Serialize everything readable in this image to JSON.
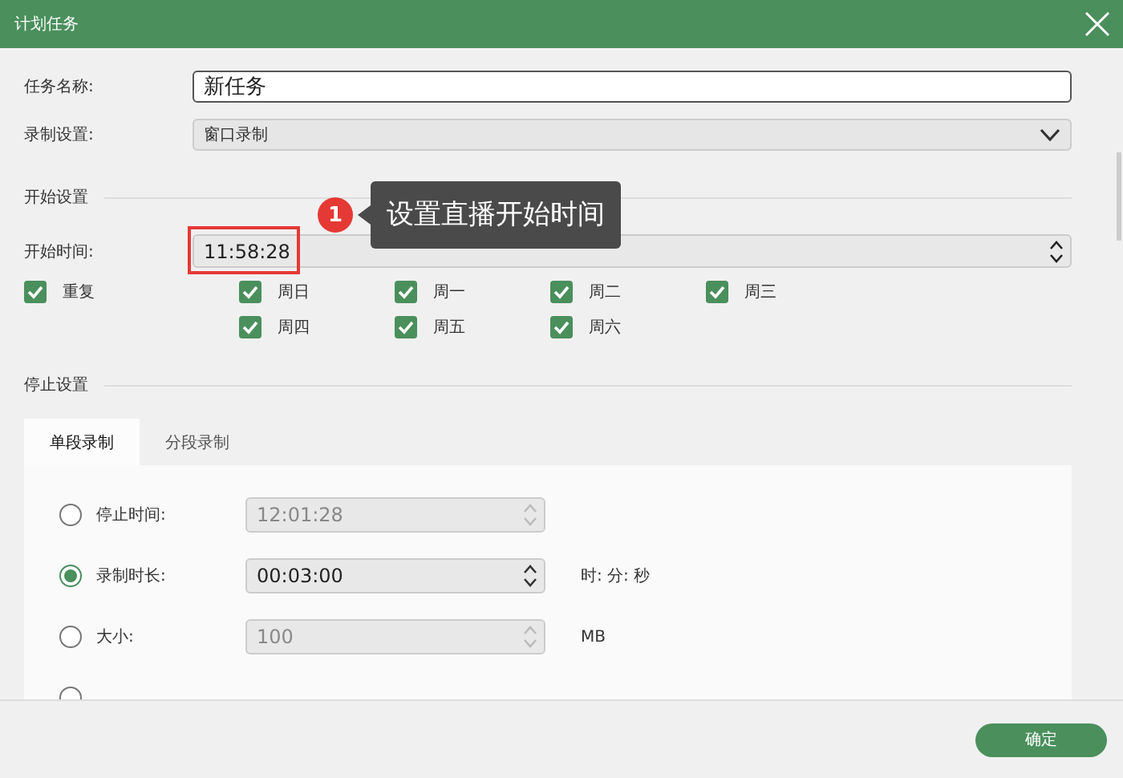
{
  "window": {
    "title": "计划任务"
  },
  "task_name": {
    "label": "任务名称:",
    "value": "新任务"
  },
  "record_setting": {
    "label": "录制设置:",
    "value": "窗口录制"
  },
  "start_section": {
    "title": "开始设置"
  },
  "start_time": {
    "label": "开始时间:",
    "value": "11:58:28",
    "highlighted": true
  },
  "repeat": {
    "label": "重复",
    "checked": true
  },
  "days": [
    {
      "label": "周日",
      "checked": true
    },
    {
      "label": "周一",
      "checked": true
    },
    {
      "label": "周二",
      "checked": true
    },
    {
      "label": "周三",
      "checked": true
    },
    {
      "label": "周四",
      "checked": true
    },
    {
      "label": "周五",
      "checked": true
    },
    {
      "label": "周六",
      "checked": true
    }
  ],
  "callout": {
    "number": "1",
    "text": "设置直播开始时间"
  },
  "stop_section": {
    "title": "停止设置"
  },
  "tabs": [
    {
      "label": "单段录制",
      "selected": true
    },
    {
      "label": "分段录制",
      "selected": false
    }
  ],
  "stop_options": [
    {
      "kind": "field",
      "label": "停止时间:",
      "selected": false,
      "value": "12:01:28",
      "disabled": true
    },
    {
      "kind": "field",
      "label": "录制时长:",
      "selected": true,
      "value": "00:03:00",
      "disabled": false,
      "unit": "时: 分: 秒"
    },
    {
      "kind": "field",
      "label": "大小:",
      "selected": false,
      "value": "100",
      "disabled": true,
      "unit": "MB"
    },
    {
      "kind": "plain",
      "selected": false
    }
  ],
  "ok_button": {
    "label": "确定"
  }
}
